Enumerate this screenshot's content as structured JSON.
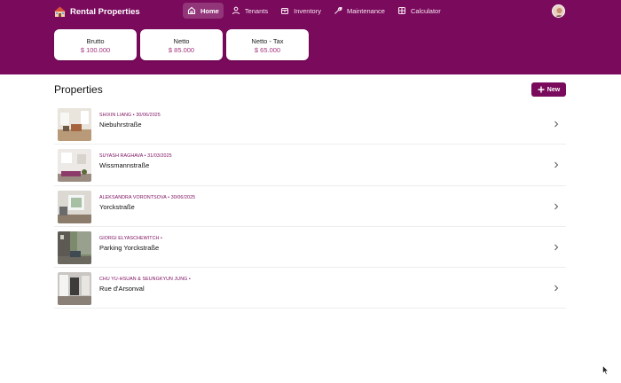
{
  "app": {
    "title": "Rental Properties",
    "logo_icon": "house-logo-icon"
  },
  "nav": [
    {
      "label": "Home",
      "icon": "home-icon",
      "active": true
    },
    {
      "label": "Tenants",
      "icon": "person-icon",
      "active": false
    },
    {
      "label": "Inventory",
      "icon": "package-icon",
      "active": false
    },
    {
      "label": "Maintenance",
      "icon": "wrench-icon",
      "active": false
    },
    {
      "label": "Calculator",
      "icon": "calculator-icon",
      "active": false
    }
  ],
  "stats": [
    {
      "label": "Brutto",
      "value": "$ 100.000"
    },
    {
      "label": "Netto",
      "value": "$ 85.000"
    },
    {
      "label": "Netto - Tax",
      "value": "$ 65.000"
    }
  ],
  "properties_section": {
    "title": "Properties",
    "new_button_label": "New"
  },
  "properties": [
    {
      "meta": "SHIXIN LIANG • 30/06/2025",
      "name": "Niebuhrstraße"
    },
    {
      "meta": "SUYASH RAGHAVA • 31/03/2025",
      "name": "Wissmannstraße"
    },
    {
      "meta": "ALEKSANDRA VORONTSOVA • 30/06/2025",
      "name": "Yorckstraße"
    },
    {
      "meta": "GIORGI ELYASCHEWITCH •",
      "name": "Parking Yorckstraße"
    },
    {
      "meta": "CHU YU-HSUAN & SEUNGKYUN JUNG •",
      "name": "Rue d'Arsonval"
    }
  ],
  "colors": {
    "brand": "#7a0a5c",
    "accent_text": "#a3357f"
  }
}
